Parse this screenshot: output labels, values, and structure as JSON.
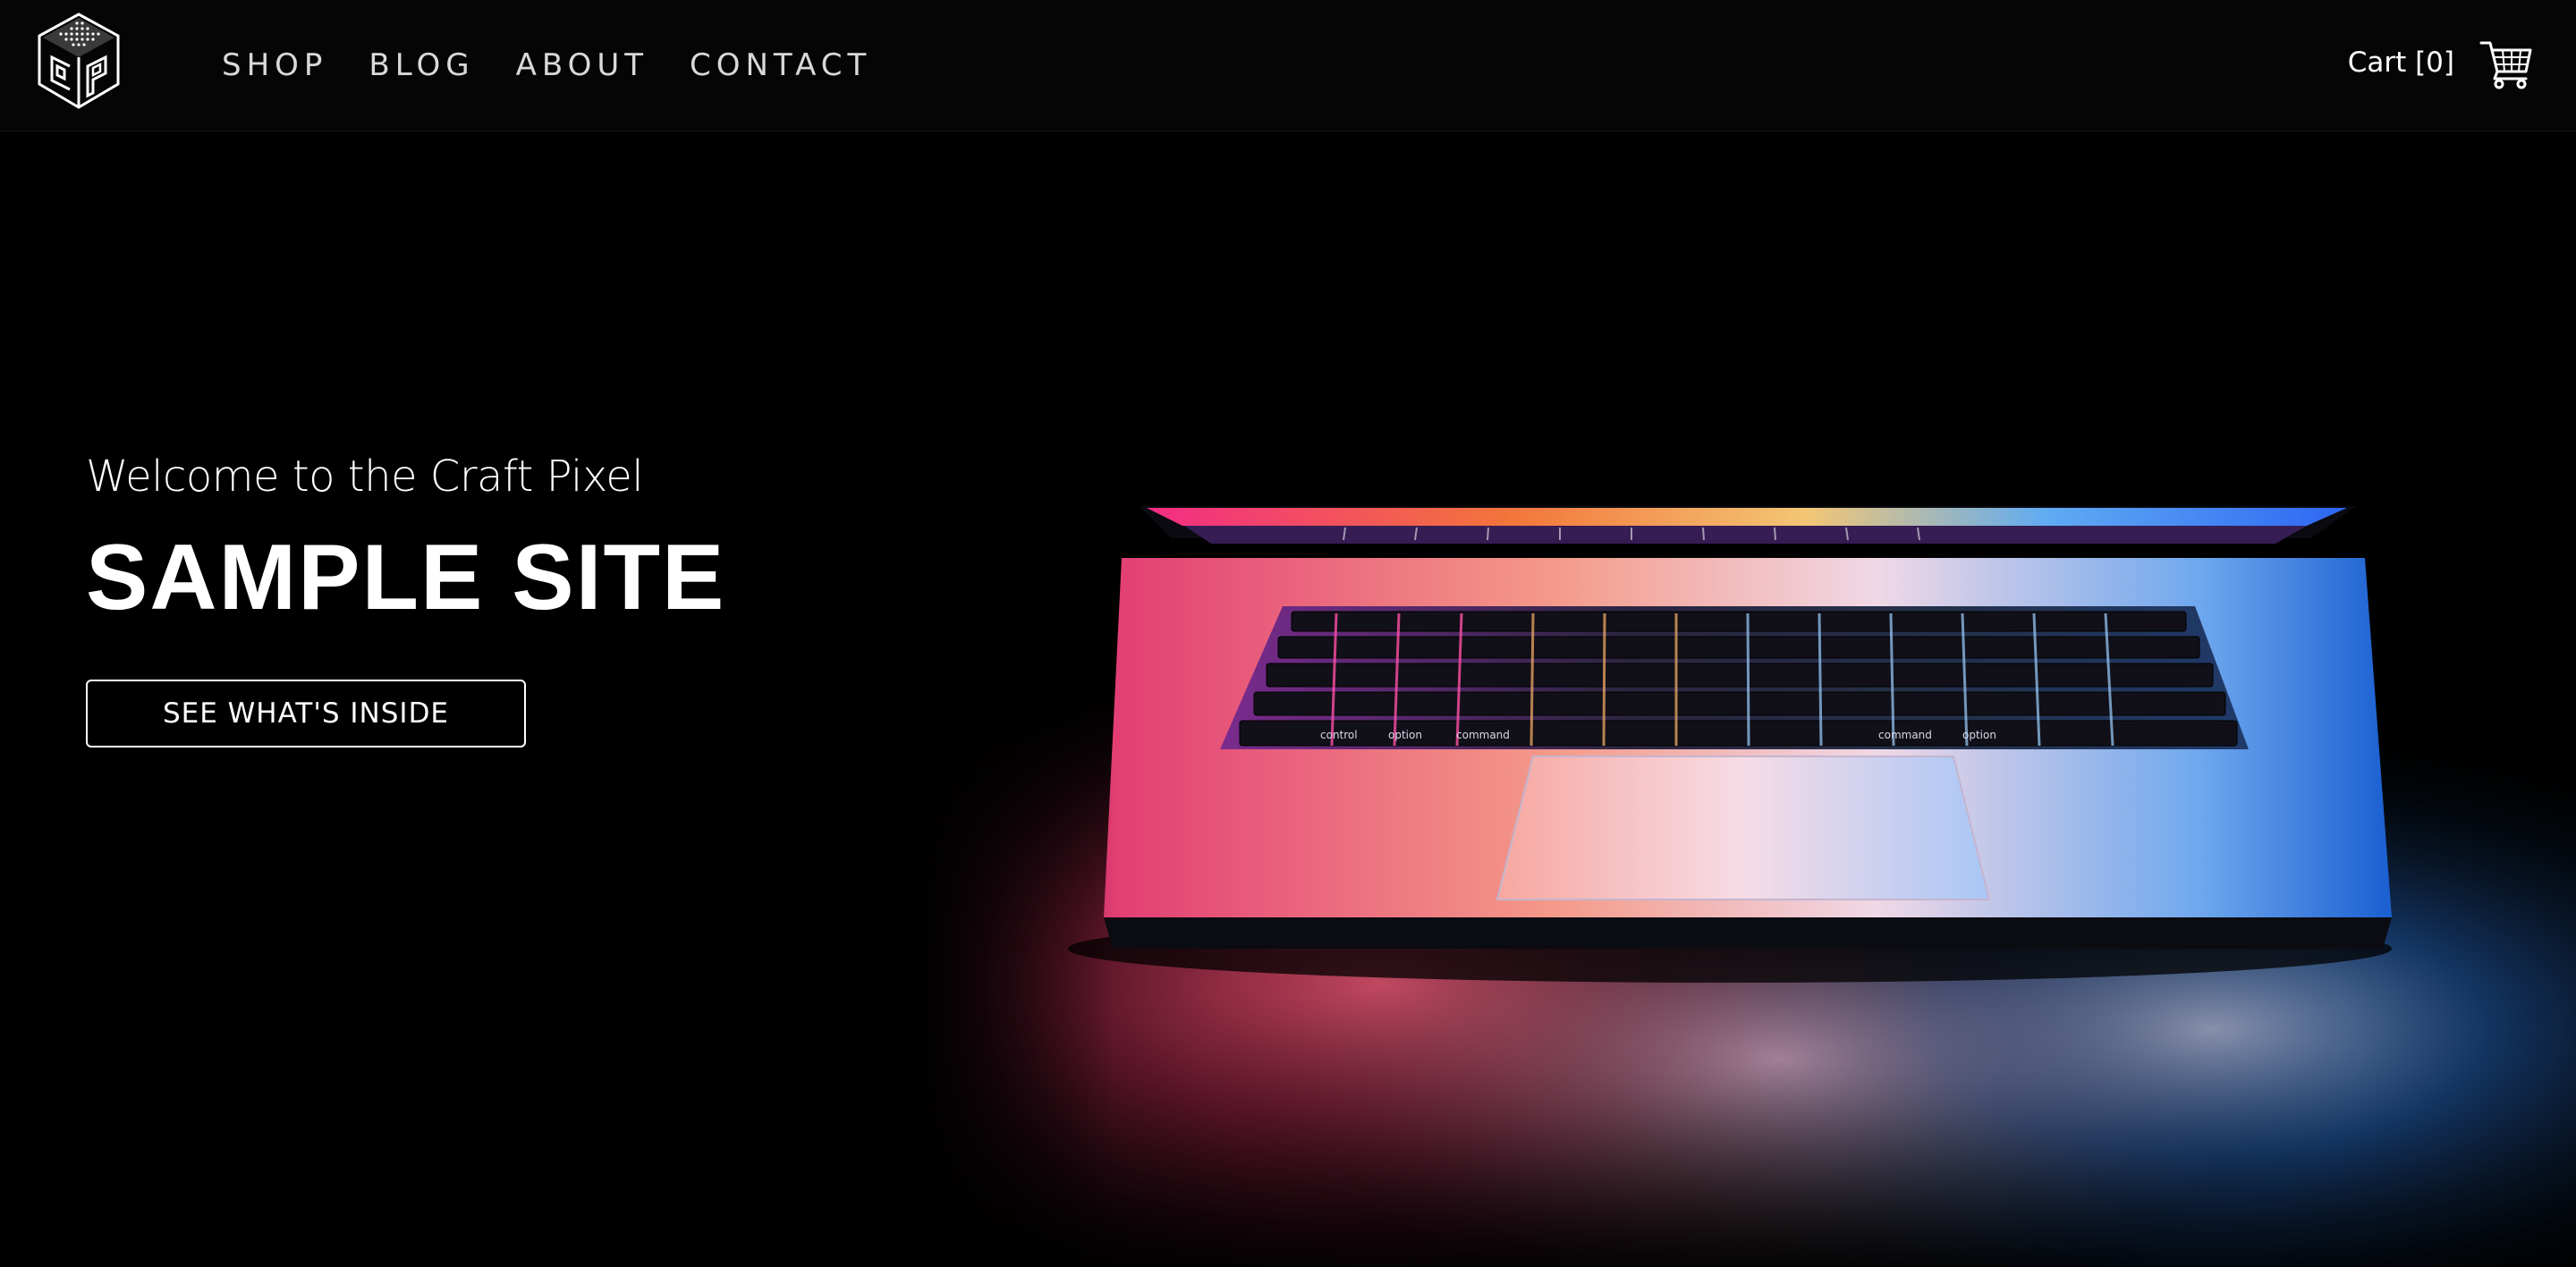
{
  "header": {
    "logo_icon": "cube-logo-icon",
    "nav": [
      {
        "label": "SHOP"
      },
      {
        "label": "BLOG"
      },
      {
        "label": "ABOUT"
      },
      {
        "label": "CONTACT"
      }
    ],
    "cart_label": "Cart [0]",
    "cart_icon": "shopping-cart-icon"
  },
  "hero": {
    "welcome": "Welcome to the Craft Pixel",
    "title": "SAMPLE SITE",
    "cta_label": "SEE WHAT'S INSIDE",
    "image_subject": "laptop-glow-image",
    "keyboard_labels": {
      "control": "control",
      "option": "option",
      "command": "command",
      "command_right": "command",
      "option_right": "option"
    }
  },
  "colors": {
    "background": "#000000",
    "text": "#ffffff",
    "nav_text": "#d9d9d9",
    "glow_pink": "#ff2e8a",
    "glow_orange": "#ff7a3d",
    "glow_blue": "#1e88ff"
  }
}
